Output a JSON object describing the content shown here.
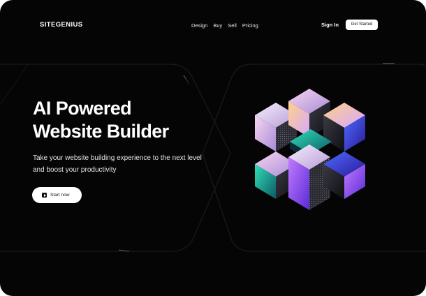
{
  "brand": {
    "name": "SITEGENIUS"
  },
  "nav": {
    "items": [
      {
        "label": "Design"
      },
      {
        "label": "Buy"
      },
      {
        "label": "Sell"
      },
      {
        "label": "Pricing"
      }
    ],
    "sign_in": "Sign In",
    "get_started": "Get Started"
  },
  "hero": {
    "title_line1": "AI Powered",
    "title_line2": "Website Builder",
    "subtitle": "Take your website building experience to the next level and boost your productivity",
    "cta_label": "Start now",
    "cta_icon": "play-icon"
  },
  "artwork": {
    "name": "iridescent-cube-cluster-illustration"
  },
  "colors": {
    "background": "#050505",
    "text": "#ffffff",
    "button_bg": "#ffffff",
    "accent_purple": "#b78cff",
    "accent_blue": "#3b5bff",
    "accent_teal": "#1fc7a6",
    "accent_orange": "#ffa63d"
  }
}
